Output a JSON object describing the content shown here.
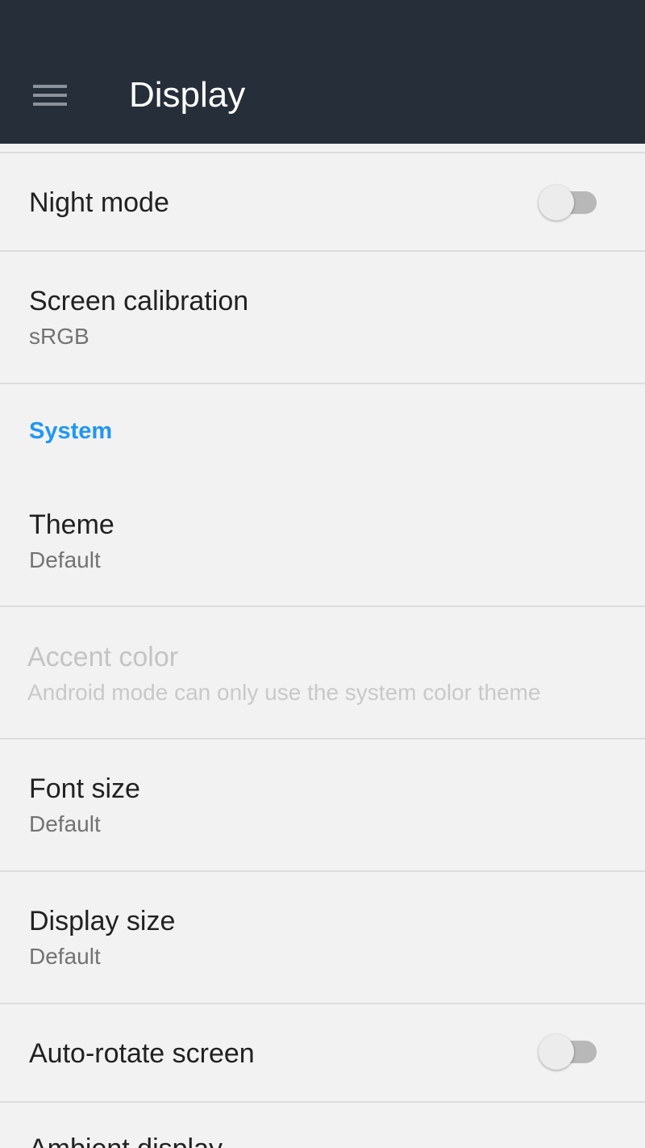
{
  "app_bar": {
    "title": "Display",
    "menu_icon": "hamburger-menu-icon",
    "background": "#262e3a"
  },
  "colors": {
    "accent": "#2196f3",
    "background": "#f2f2f2"
  },
  "settings": {
    "night_mode": {
      "title": "Night mode",
      "enabled": false
    },
    "screen_calibration": {
      "title": "Screen calibration",
      "summary": "sRGB"
    },
    "system_header": "System",
    "theme": {
      "title": "Theme",
      "summary": "Default"
    },
    "accent_color": {
      "title": "Accent color",
      "summary": "Android mode can only use the system color theme",
      "disabled": true
    },
    "font_size": {
      "title": "Font size",
      "summary": "Default"
    },
    "display_size": {
      "title": "Display size",
      "summary": "Default"
    },
    "auto_rotate": {
      "title": "Auto-rotate screen",
      "enabled": false
    },
    "ambient_display": {
      "title": "Ambient display"
    }
  }
}
